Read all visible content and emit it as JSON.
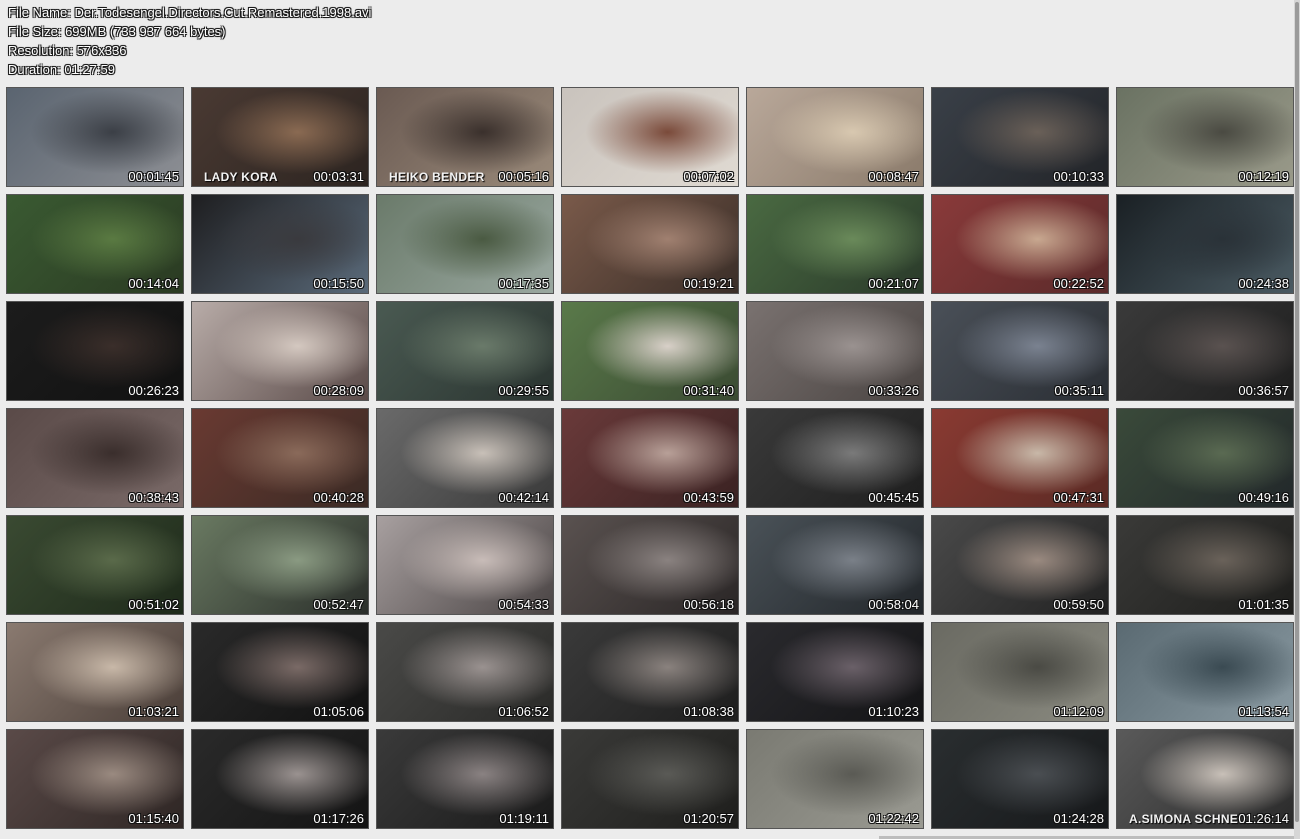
{
  "info": {
    "file_name": "File Name: Der.Todesengel.Directors.Cut.Remastered.1998.avi",
    "file_size": "File Size: 699MB (733 937 664 bytes)",
    "resolution": "Resolution: 576x336",
    "duration": "Duration: 01:27:59"
  },
  "thumbnails": [
    {
      "time": "00:01:45",
      "caption": "",
      "colors": [
        "#5a6470",
        "#3b3f46",
        "#8d8f94"
      ]
    },
    {
      "time": "00:03:31",
      "caption": "LADY KORA",
      "colors": [
        "#4a3a33",
        "#8a6a52",
        "#2c2420"
      ]
    },
    {
      "time": "00:05:16",
      "caption": "HEIKO BENDER",
      "colors": [
        "#6a5a52",
        "#3a302c",
        "#9a8a7a"
      ]
    },
    {
      "time": "00:07:02",
      "caption": "",
      "colors": [
        "#c9c3bd",
        "#7a4a3a",
        "#e0dad2"
      ]
    },
    {
      "time": "00:08:47",
      "caption": "",
      "colors": [
        "#b9a89a",
        "#d8c8b0",
        "#8a7a6a"
      ]
    },
    {
      "time": "00:10:33",
      "caption": "",
      "colors": [
        "#3a4048",
        "#6a6058",
        "#222428"
      ]
    },
    {
      "time": "00:12:19",
      "caption": "",
      "colors": [
        "#6a7262",
        "#4a4a42",
        "#9a9a8a"
      ]
    },
    {
      "time": "00:14:04",
      "caption": "",
      "colors": [
        "#3a5a32",
        "#5a7a42",
        "#2a3a22"
      ]
    },
    {
      "time": "00:15:50",
      "caption": "",
      "colors": [
        "#1e1e20",
        "#3a3a3e",
        "#5a6a7a"
      ]
    },
    {
      "time": "00:17:35",
      "caption": "",
      "colors": [
        "#6a7a6a",
        "#4a5a42",
        "#9aa8a0"
      ]
    },
    {
      "time": "00:19:21",
      "caption": "",
      "colors": [
        "#7a5a4a",
        "#a08070",
        "#3a2e28"
      ]
    },
    {
      "time": "00:21:07",
      "caption": "",
      "colors": [
        "#4a6a42",
        "#6a8a5a",
        "#2a3a2a"
      ]
    },
    {
      "time": "00:22:52",
      "caption": "",
      "colors": [
        "#8a3a3a",
        "#c8a890",
        "#5a2a2a"
      ]
    },
    {
      "time": "00:24:38",
      "caption": "",
      "colors": [
        "#1a2024",
        "#2a3238",
        "#4a5a62"
      ]
    },
    {
      "time": "00:26:23",
      "caption": "",
      "colors": [
        "#1c1c1c",
        "#3a2e2a",
        "#111"
      ]
    },
    {
      "time": "00:28:09",
      "caption": "",
      "colors": [
        "#b8aca8",
        "#d4c8c0",
        "#5a4a48"
      ]
    },
    {
      "time": "00:29:55",
      "caption": "",
      "colors": [
        "#4a5a52",
        "#6a7a6a",
        "#2a3430"
      ]
    },
    {
      "time": "00:31:40",
      "caption": "",
      "colors": [
        "#5a7a4a",
        "#d8d0c8",
        "#3a4a32"
      ]
    },
    {
      "time": "00:33:26",
      "caption": "",
      "colors": [
        "#7a7270",
        "#9a9290",
        "#4a4442"
      ]
    },
    {
      "time": "00:35:11",
      "caption": "",
      "colors": [
        "#4a5058",
        "#7a8290",
        "#2a2e34"
      ]
    },
    {
      "time": "00:36:57",
      "caption": "",
      "colors": [
        "#3a3a3a",
        "#5a5250",
        "#1e1e1e"
      ]
    },
    {
      "time": "00:38:43",
      "caption": "",
      "colors": [
        "#5a4a48",
        "#3a2e2c",
        "#7a6a68"
      ]
    },
    {
      "time": "00:40:28",
      "caption": "",
      "colors": [
        "#6a3a32",
        "#8a6a5a",
        "#3a2a24"
      ]
    },
    {
      "time": "00:42:14",
      "caption": "",
      "colors": [
        "#6a6a6a",
        "#c8c0b8",
        "#3a3a3a"
      ]
    },
    {
      "time": "00:43:59",
      "caption": "",
      "colors": [
        "#6a3a3a",
        "#b8a098",
        "#3a2222"
      ]
    },
    {
      "time": "00:45:45",
      "caption": "",
      "colors": [
        "#3a3a3a",
        "#7a7a7a",
        "#1e1e1e"
      ]
    },
    {
      "time": "00:47:31",
      "caption": "",
      "colors": [
        "#8a3a32",
        "#c8b8a8",
        "#5a2a24"
      ]
    },
    {
      "time": "00:49:16",
      "caption": "",
      "colors": [
        "#3a4a3a",
        "#5a6a52",
        "#22282a"
      ]
    },
    {
      "time": "00:51:02",
      "caption": "",
      "colors": [
        "#3a4a32",
        "#5a6a4a",
        "#1e2a1a"
      ]
    },
    {
      "time": "00:52:47",
      "caption": "",
      "colors": [
        "#6a7a62",
        "#8a9a82",
        "#2a2e2a"
      ]
    },
    {
      "time": "00:54:33",
      "caption": "",
      "colors": [
        "#a8a0a0",
        "#c8bcb8",
        "#4a4444"
      ]
    },
    {
      "time": "00:56:18",
      "caption": "",
      "colors": [
        "#5a5250",
        "#8a8280",
        "#2a2626"
      ]
    },
    {
      "time": "00:58:04",
      "caption": "",
      "colors": [
        "#4a5258",
        "#7a8088",
        "#22262a"
      ]
    },
    {
      "time": "00:59:50",
      "caption": "",
      "colors": [
        "#4a4a4a",
        "#9a8a80",
        "#222"
      ]
    },
    {
      "time": "01:01:35",
      "caption": "",
      "colors": [
        "#3a3a38",
        "#6a625a",
        "#1e1e1c"
      ]
    },
    {
      "time": "01:03:21",
      "caption": "",
      "colors": [
        "#8a7a70",
        "#c8b8a8",
        "#4a3e38"
      ]
    },
    {
      "time": "01:05:06",
      "caption": "",
      "colors": [
        "#2a2a2a",
        "#7a6a66",
        "#111"
      ]
    },
    {
      "time": "01:06:52",
      "caption": "",
      "colors": [
        "#4a4a48",
        "#9a9290",
        "#2a2a28"
      ]
    },
    {
      "time": "01:08:38",
      "caption": "",
      "colors": [
        "#3a3a3a",
        "#8a827e",
        "#1e1e1e"
      ]
    },
    {
      "time": "01:10:23",
      "caption": "",
      "colors": [
        "#2a2a2e",
        "#6a6068",
        "#141416"
      ]
    },
    {
      "time": "01:12:09",
      "caption": "",
      "colors": [
        "#6a6a62",
        "#4a4a44",
        "#8a8a80"
      ]
    },
    {
      "time": "01:13:54",
      "caption": "",
      "colors": [
        "#5a6a72",
        "#3a4a52",
        "#8a9aa2"
      ]
    },
    {
      "time": "01:15:40",
      "caption": "",
      "colors": [
        "#5a4a48",
        "#9a8a80",
        "#2e2624"
      ]
    },
    {
      "time": "01:17:26",
      "caption": "",
      "colors": [
        "#2a2a2a",
        "#9a9290",
        "#141414"
      ]
    },
    {
      "time": "01:19:11",
      "caption": "",
      "colors": [
        "#3a3a3a",
        "#8a8282",
        "#1a1a1a"
      ]
    },
    {
      "time": "01:20:57",
      "caption": "",
      "colors": [
        "#3a3a38",
        "#5a5a56",
        "#1e1e1c"
      ]
    },
    {
      "time": "01:22:42",
      "caption": "",
      "colors": [
        "#7a7a72",
        "#5a5a54",
        "#9a9a92"
      ]
    },
    {
      "time": "01:24:28",
      "caption": "",
      "colors": [
        "#2a2e30",
        "#4a4e52",
        "#16181a"
      ]
    },
    {
      "time": "01:26:14",
      "caption": "A.SIMONA SCHNE...",
      "colors": [
        "#5a5a5a",
        "#c8c0b8",
        "#2a2a2a"
      ]
    }
  ]
}
